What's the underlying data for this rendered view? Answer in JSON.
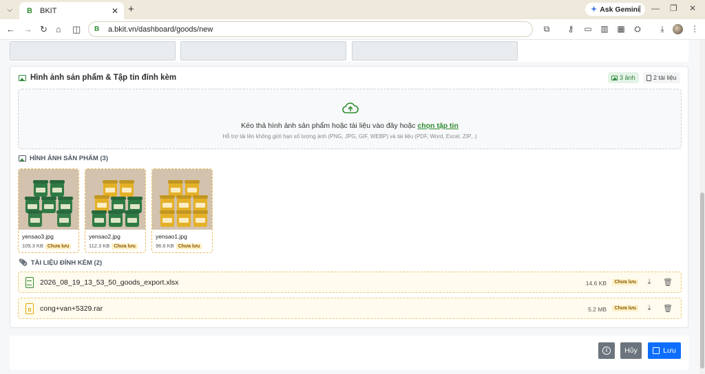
{
  "browser": {
    "tab_title": "BKIT",
    "favicon_letter": "B",
    "gemini_label": "Ask Gemini",
    "url": "a.bkit.vn/dashboard/goods/new"
  },
  "section": {
    "title": "Hình ảnh sản phẩm & Tập tin đính kèm",
    "images_badge": "3 ảnh",
    "docs_badge": "2 tài liệu"
  },
  "dropzone": {
    "main_text": "Kéo thả hình ảnh sản phẩm hoặc tài liệu vào đây hoặc",
    "link_text": "chọn tập tin",
    "sub_text": "Hỗ trợ tải lên không giới hạn số lượng ảnh (PNG, JPG, GIF, WEBP) và tài liệu (PDF, Word, Excel, ZIP...)"
  },
  "images": {
    "heading": "HÌNH ẢNH SẢN PHẨM (3)",
    "items": [
      {
        "name": "yensao3.jpg",
        "size": "109.3 KB",
        "status": "Chưa lưu"
      },
      {
        "name": "yensao2.jpg",
        "size": "112.3 KB",
        "status": "Chưa lưu"
      },
      {
        "name": "yensao1.jpg",
        "size": "96.6 KB",
        "status": "Chưa lưu"
      }
    ]
  },
  "docs": {
    "heading": "TÀI LIỆU ĐÍNH KÈM (2)",
    "items": [
      {
        "name": "2026_08_19_13_53_50_goods_export.xlsx",
        "size": "14.6 KB",
        "status": "Chưa lưu",
        "icon": "excel-file-icon",
        "icon_color": "#2e8b2e"
      },
      {
        "name": "cong+van+5329.rar",
        "size": "5.2 MB",
        "status": "Chưa lưu",
        "icon": "archive-file-icon",
        "icon_color": "#e0a800"
      }
    ]
  },
  "footer": {
    "cancel_label": "Hủy",
    "save_label": "Lưu"
  }
}
